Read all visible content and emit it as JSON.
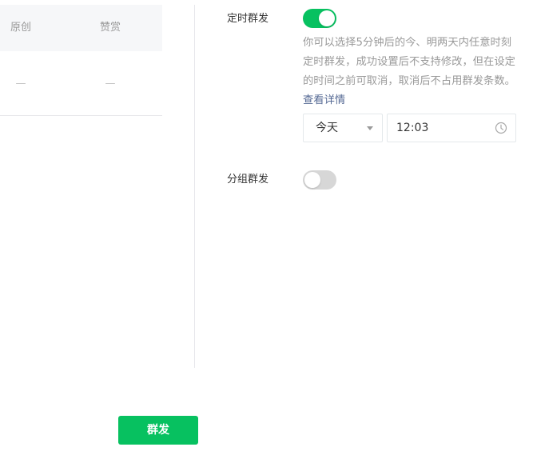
{
  "stats": {
    "col_original": "原创",
    "col_reward": "赞赏",
    "val_original": "—",
    "val_reward": "—"
  },
  "scheduled": {
    "label": "定时群发",
    "enabled": true,
    "desc": "你可以选择5分钟后的今、明两天内任意时刻定时群发，成功设置后不支持修改，但在设定的时间之前可取消，取消后不占用群发条数。",
    "link": "查看详情",
    "day": "今天",
    "time": "12:03"
  },
  "group": {
    "label": "分组群发",
    "enabled": false
  },
  "actions": {
    "publish_label": "群发"
  },
  "colors": {
    "accent": "#07c160",
    "link": "#576b95"
  },
  "icons": {
    "day_dropdown": "chevron-down-icon",
    "time_picker": "clock-icon"
  }
}
